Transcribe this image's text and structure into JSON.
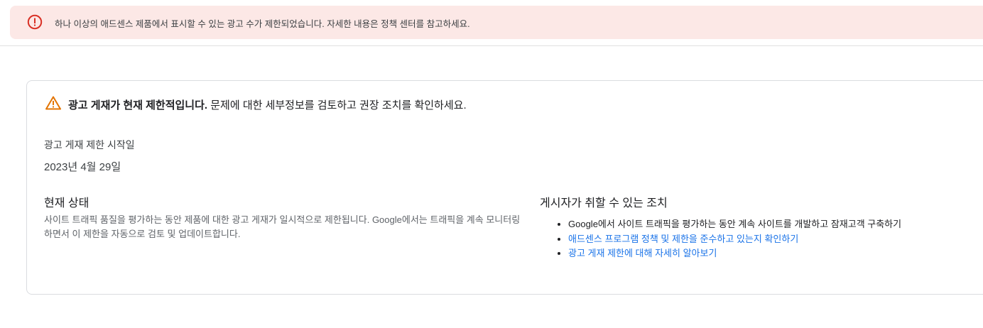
{
  "alert": {
    "icon": "error-circle-icon",
    "icon_color": "#d93025",
    "background": "#fce8e6",
    "text": "하나 이상의 애드센스 제품에서 표시할 수 있는 광고 수가 제한되었습니다. 자세한 내용은 정책 센터를 참고하세요."
  },
  "card": {
    "warning": {
      "icon": "warning-triangle-icon",
      "icon_color": "#e37400",
      "bold_text": "광고 게재가 현재 제한적입니다.",
      "text": " 문제에 대한 세부정보를 검토하고 권장 조치를 확인하세요."
    },
    "start": {
      "label": "광고 게재 제한 시작일",
      "date": "2023년 4월 29일"
    },
    "status": {
      "title": "현재 상태",
      "description": "사이트 트래픽 품질을 평가하는 동안 제품에 대한 광고 게재가 일시적으로 제한됩니다. Google에서는 트래픽을 계속 모니터링하면서 이 제한을 자동으로 검토 및 업데이트합니다."
    },
    "actions": {
      "title": "게시자가 취할 수 있는 조치",
      "items": [
        {
          "label": "Google에서 사이트 트래픽을 평가하는 동안 계속 사이트를 개발하고 잠재고객 구축하기",
          "is_link": false
        },
        {
          "label": "애드센스 프로그램 정책 및 제한을 준수하고 있는지 확인하기",
          "is_link": true
        },
        {
          "label": "광고 게재 제한에 대해 자세히 알아보기",
          "is_link": true
        }
      ],
      "link_color": "#1a73e8"
    }
  }
}
